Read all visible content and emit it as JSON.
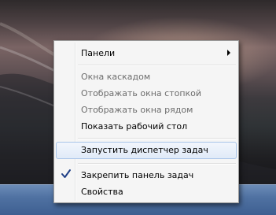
{
  "menu": {
    "items": {
      "toolbars": "Панели",
      "cascade": "Окна каскадом",
      "stacked": "Отображать окна стопкой",
      "side_by_side": "Отображать окна рядом",
      "show_desktop": "Показать рабочий стол",
      "task_manager": "Запустить диспетчер задач",
      "lock_taskbar": "Закрепить панель задач",
      "properties": "Свойства"
    },
    "lock_taskbar_checked": true
  },
  "icons": {
    "submenu": "chevron-right-icon",
    "checked": "check-icon"
  },
  "colors": {
    "menu_bg": "#f5f5f5",
    "hover_bg": "#e0eaf8",
    "hover_border": "#a8c4e8",
    "disabled_text": "#6d6d6d",
    "taskbar": "#5072a2"
  }
}
